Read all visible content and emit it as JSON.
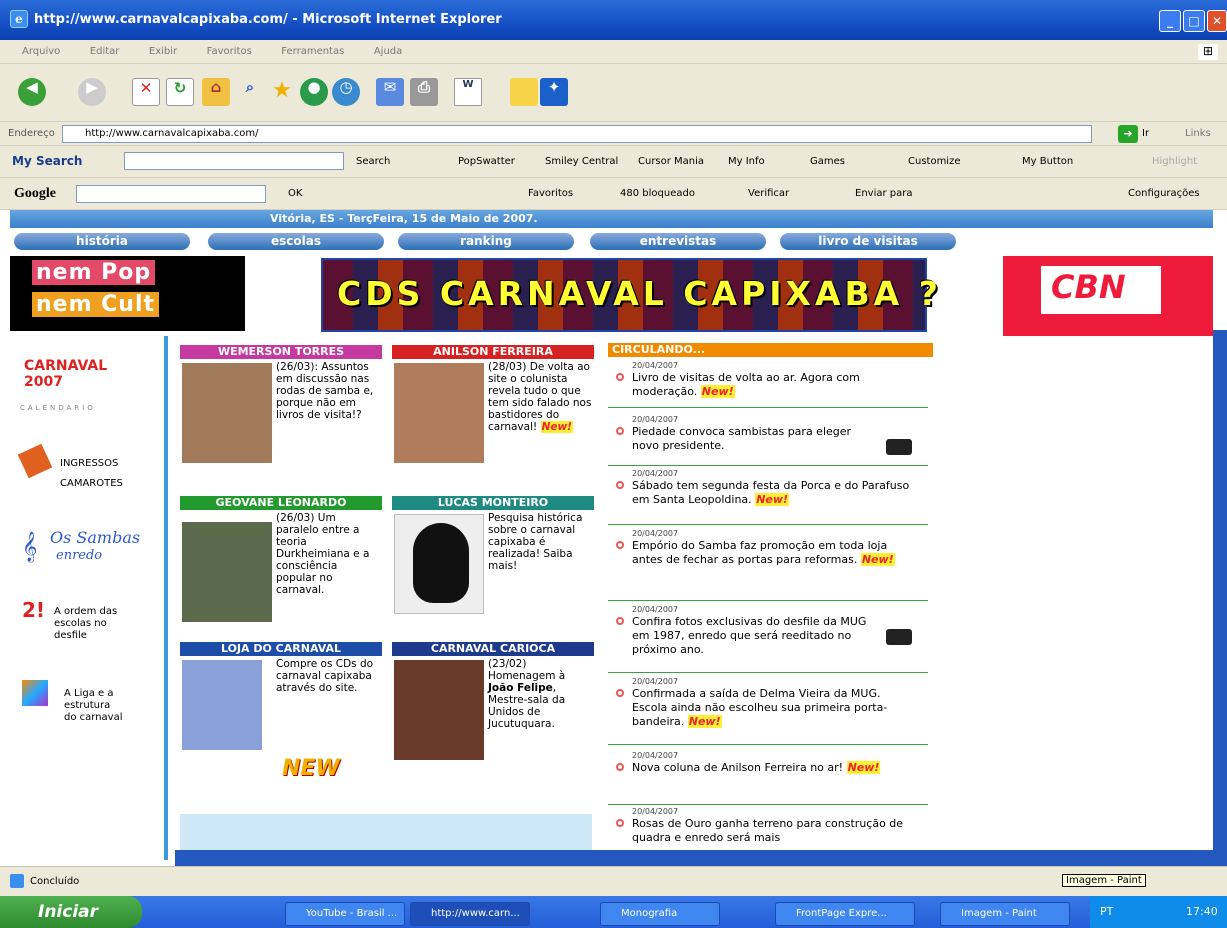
{
  "window": {
    "title": "http://www.carnavalcapixaba.com/ - Microsoft Internet Explorer"
  },
  "menu": [
    "Arquivo",
    "Editar",
    "Exibir",
    "Favoritos",
    "Ferramentas",
    "Ajuda"
  ],
  "address": {
    "label": "Endereço",
    "url": "http://www.carnavalcapixaba.com/",
    "go": "Ir",
    "links": "Links"
  },
  "searchbar": {
    "logo": "My Search",
    "search": "Search",
    "popswatter": "PopSwatter",
    "smiley": "Smiley Central",
    "cursor": "Cursor Mania",
    "myinfo": "My Info",
    "games": "Games",
    "customize": "Customize",
    "mybutton": "My Button",
    "highlight": "Highlight"
  },
  "googlebar": {
    "logo": "Google",
    "ok": "OK",
    "favoritos": "Favoritos",
    "bloqueado": "480 bloqueado",
    "verificar": "Verificar",
    "enviar": "Enviar para",
    "config": "Configurações"
  },
  "page": {
    "dateline": "Vitória, ES - TerçFeira, 15 de Maio de 2007.",
    "nav": [
      "história",
      "escolas",
      "ranking",
      "entrevistas",
      "livro de visitas"
    ],
    "banner_nempop": [
      "nem Pop",
      "nem Cult"
    ],
    "banner_cd": "CDS CARNAVAL CAPIXABA ?",
    "banner_cbn": "CBN",
    "left": [
      "CARNAVAL 2007",
      "CALENDÁRIO",
      "INGRESSOS",
      "CAMAROTES",
      "Os Sambas",
      "enredo",
      "A ordem das",
      "escolas no",
      "desfile",
      "A Liga e a",
      "estrutura",
      "do carnaval"
    ],
    "columnists": [
      {
        "name": "WEMERSON TORRES",
        "color": "#c43aa0",
        "text": "(26/03): Assuntos em discussão nas rodas de samba e, porque não em livros de visita!?"
      },
      {
        "name": "ANILSON FERREIRA",
        "color": "#d62222",
        "text": "(28/03) De volta ao site o colunista revela tudo o que tem sido falado nos bastidores do carnaval!"
      },
      {
        "name": "GEOVANE LEONARDO",
        "color": "#229a2e",
        "text": "(26/03) Um paralelo entre a teoria Durkheimiana e a consciência popular no carnaval."
      },
      {
        "name": "LUCAS MONTEIRO",
        "color": "#1e8a82",
        "text": "Pesquisa histórica sobre o carnaval capixaba é realizada! Saiba mais!"
      },
      {
        "name": "LOJA DO CARNAVAL",
        "color": "#1e4da8",
        "text": "Compre os CDs do carnaval capixaba através do site."
      },
      {
        "name": "CARNAVAL CARIOCA",
        "color": "#1e3a8c",
        "text": "(23/02) Homenagem à ",
        "bold": "João Felipe",
        "text2": ", Mestre-sala da Unidos de Jucutuquara."
      }
    ],
    "new_tag": "New!",
    "new_sticker": "NEW",
    "circulando": {
      "title": "CIRCULANDO...",
      "items": [
        {
          "date": "20/04/2007",
          "text": "Livro de visitas de volta ao ar. Agora com moderação."
        },
        {
          "date": "20/04/2007",
          "text": "Piedade convoca sambistas para eleger novo presidente."
        },
        {
          "date": "20/04/2007",
          "text": "Sábado tem segunda festa da Porca e do Parafuso em Santa Leopoldina."
        },
        {
          "date": "20/04/2007",
          "text": "Empório do Samba faz promoção em toda loja antes de fechar as portas para reformas."
        },
        {
          "date": "20/04/2007",
          "text": "Confira fotos exclusivas do desfile da MUG em 1987, enredo que será reeditado no próximo ano."
        },
        {
          "date": "20/04/2007",
          "text": "Confirmada a saída de Delma Vieira da MUG. Escola ainda não escolheu sua primeira porta-bandeira."
        },
        {
          "date": "20/04/2007",
          "text": "Nova coluna de Anilson Ferreira no ar!"
        },
        {
          "date": "20/04/2007",
          "text": "Rosas de Ouro ganha terreno para construção de quadra e enredo será mais"
        }
      ]
    }
  },
  "status": {
    "text": "Concluído",
    "tooltip": "Imagem - Paint"
  },
  "taskbar": {
    "start": "Iniciar",
    "tasks": [
      "YouTube - Brasil ...",
      "http://www.carn...",
      "Monografia",
      "FrontPage Expre...",
      "Imagem - Paint"
    ],
    "lang": "PT",
    "time": "17:40"
  }
}
